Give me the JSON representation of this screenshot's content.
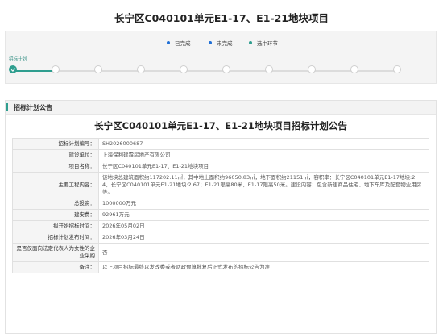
{
  "page": {
    "title": "长宁区C040101单元E1-17、E1-21地块项目"
  },
  "stepper": {
    "legend": [
      {
        "label": "已完成",
        "color": "#1f6fd6"
      },
      {
        "label": "未完成",
        "color": "#1f6fd6"
      },
      {
        "label": "选中环节",
        "color": "#2f9e8f"
      }
    ],
    "steps": [
      {
        "label": "招标计划",
        "status": "done"
      },
      {
        "label": "",
        "status": "pending"
      },
      {
        "label": "",
        "status": "pending"
      },
      {
        "label": "",
        "status": "pending"
      },
      {
        "label": "",
        "status": "pending"
      },
      {
        "label": "",
        "status": "pending"
      },
      {
        "label": "",
        "status": "pending"
      },
      {
        "label": "",
        "status": "pending"
      },
      {
        "label": "",
        "status": "pending"
      },
      {
        "label": "",
        "status": "pending"
      }
    ],
    "accent_color": "#2f9e8f"
  },
  "announcement": {
    "section_heading": "招标计划公告",
    "title": "长宁区C040101单元E1-17、E1-21地块项目招标计划公告",
    "rows": [
      {
        "label": "招标计划编号：",
        "value": "SH2026000687"
      },
      {
        "label": "建设单位：",
        "value": "上海保利建霖房地产有限公司"
      },
      {
        "label": "项目名称：",
        "value": "长宁区C040101单元E1-17、E1-21地块项目"
      },
      {
        "label": "主要工程内容：",
        "value": "该地块总建筑面积约117202.11㎡，其中地上面积约96050.83㎡，地下面积约21151㎡，容积率：长宁区C040101单元E1-17地块:2.4，长宁区C040101单元E1-21地块:2.67；E1-21限高80米，E1-17限高50米。建设内容：包含新建商品住宅、地下车库及配套物业用房等。"
      },
      {
        "label": "总投资：",
        "value": "1000000万元"
      },
      {
        "label": "建安费：",
        "value": "92961万元"
      },
      {
        "label": "拟开始招标时间：",
        "value": "2026年05月02日"
      },
      {
        "label": "招标计划发布时间：",
        "value": "2026年03月24日"
      },
      {
        "label": "是否仅面向法定代表人为女性的企业采购",
        "value": "否"
      },
      {
        "label": "备注：",
        "value": "以上项目招标最终以发改委或者财政预算批复后正式发布的招标公告为准"
      }
    ]
  }
}
